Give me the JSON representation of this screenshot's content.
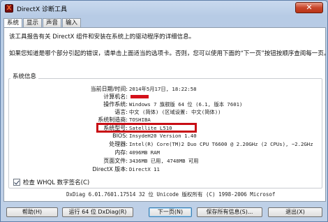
{
  "window": {
    "title": "DirectX 诊断工具",
    "close_label": "✕",
    "app_icon_glyph": "X"
  },
  "tabs": [
    {
      "label": "系统",
      "active": true
    },
    {
      "label": "显示",
      "active": false
    },
    {
      "label": "声音",
      "active": false
    },
    {
      "label": "输入",
      "active": false
    }
  ],
  "intro": {
    "line1": "该工具报告有关 DirectX 组件和安装在系统上的驱动程序的详细信息。",
    "line2": "如果您知道是哪个部分引起的错误，请单击上面适当的选项卡。否则，您可以使用下面的“下一页”按钮按顺序查阅每一页。"
  },
  "system_info": {
    "group_title": "系统信息",
    "rows": [
      {
        "label": "当前日期/时间:",
        "value": "2014年5月17日, 18:22:58"
      },
      {
        "label": "计算机名:",
        "value": "",
        "redacted": true
      },
      {
        "label": "操作系统:",
        "value": "Windows 7 旗舰版 64 位 (6.1, 版本 7601)"
      },
      {
        "label": "语言:",
        "value": "中文 (简体) (区域设置: 中文(简体))"
      },
      {
        "label": "系统制造商:",
        "value": "TOSHIBA"
      },
      {
        "label": "系统型号:",
        "value": "Satellite L510",
        "highlighted": true
      },
      {
        "label": "BIOS:",
        "value": "InsydeH20 Version 1.40"
      },
      {
        "label": "处理器:",
        "value": "Intel(R) Core(TM)2 Duo CPU     T6600  @ 2.20GHz (2 CPUs), ~2.2GHz"
      },
      {
        "label": "内存:",
        "value": "4096MB RAM"
      },
      {
        "label": "页面文件:",
        "value": "3436MB 已用, 4748MB 可用"
      },
      {
        "label": "DirectX 版本:",
        "value": "DirectX 11"
      }
    ],
    "highlight_color": "#c80d14"
  },
  "whql_check": {
    "label": "检查 WHQL 数字签名(C)",
    "checked": true
  },
  "footer_info": "DxDiag 6.01.7601.17514 32 位 Unicode 版权所有 (C) 1998-2006 Microsof",
  "buttons": {
    "help": "帮助(H)",
    "run64": "运行 64 位 DxDiag(R)",
    "next": "下一页(N)",
    "save": "保存所有信息(S)...",
    "exit": "退出(X)"
  }
}
